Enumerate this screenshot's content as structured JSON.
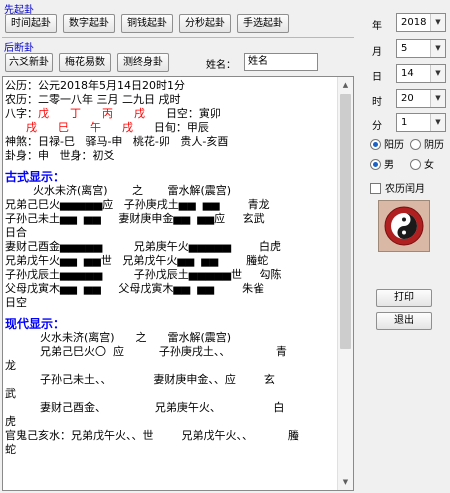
{
  "top_group": {
    "label": "先起卦",
    "buttons": [
      "时间起卦",
      "数字起卦",
      "铜钱起卦",
      "分秒起卦",
      "手选起卦"
    ]
  },
  "mid_group": {
    "label": "后断卦",
    "buttons": [
      "六爻新卦",
      "梅花易数",
      "测终身卦"
    ],
    "name_label": "姓名：",
    "name_value": "姓名"
  },
  "date_panel": {
    "year": {
      "label": "年",
      "value": "2018"
    },
    "month": {
      "label": "月",
      "value": "5"
    },
    "day": {
      "label": "日",
      "value": "14"
    },
    "hour": {
      "label": "时",
      "value": "20"
    },
    "minute": {
      "label": "分",
      "value": "1"
    },
    "calendar": {
      "solar": "阳历",
      "lunar": "阴历",
      "selected": "solar"
    },
    "gender": {
      "male": "男",
      "female": "女",
      "selected": "male"
    },
    "leap_month": "农历闰月",
    "print": "打印",
    "exit": "退出"
  },
  "reading": {
    "gongli": "公历：公元2018年5月14日20时1分",
    "nongli": "农历：二零一八年 三月 二九日 戌时",
    "bazi": {
      "label": "八字：",
      "row1": [
        "戊",
        "丁",
        "丙",
        "戌"
      ],
      "row1_note": "日空：寅卯",
      "row2": [
        "戌",
        "巳",
        "午",
        "戌"
      ],
      "row2_note": "日旬：甲辰"
    },
    "shensha": "神煞：日禄-巳   驿马-申   桃花-卯   贵人-亥酉",
    "gua_shen": "卦身：申   世身：初爻",
    "classic_header": "古式显示：",
    "classic_title": "        火水未济(离宫)       之       雷水解(震宫)",
    "classic_lines": [
      "兄弟己巳火▅▅▅▅▅应   子孙庚戌土▅▅  ▅▅        青龙",
      "子孙己未土▅▅  ▅▅     妻财庚申金▅▅  ▅▅应     玄武",
      "日合",
      "妻财己酉金▅▅▅▅▅         兄弟庚午火▅▅▅▅▅        白虎",
      "兄弟戊午火▅▅  ▅▅世   兄弟戊午火▅▅  ▅▅        螣蛇",
      "子孙戊辰土▅▅▅▅▅         子孙戊辰土▅▅▅▅▅世     勾陈",
      "父母戊寅木▅▅  ▅▅     父母戊寅木▅▅  ▅▅        朱雀",
      "日空"
    ],
    "modern_header": "现代显示：",
    "modern_title": "          火水未济(离宫)      之      雷水解(震宫)",
    "modern_lines": [
      "          兄弟己巳火〇  应          子孙庚戌土、、             青",
      "龙",
      "          子孙己未土、、            妻财庚申金、、应        玄",
      "武",
      "          妻财己酉金、              兄弟庚午火、               白",
      "虎",
      "官鬼己亥水：兄弟戊午火、、世        兄弟戊午火、、          螣",
      "蛇"
    ]
  }
}
